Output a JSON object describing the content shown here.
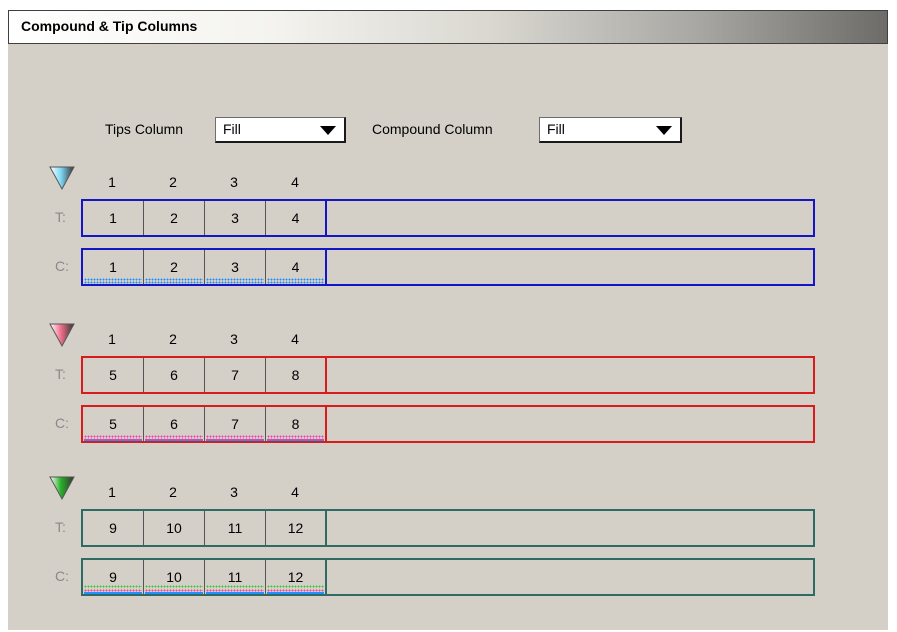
{
  "title": "Compound & Tip Columns",
  "controls": {
    "tips_label": "Tips Column",
    "tips_value": "Fill",
    "compound_label": "Compound Column",
    "compound_value": "Fill"
  },
  "row_labels": {
    "tips": "T:",
    "compound": "C:"
  },
  "groups": [
    {
      "color": "#1515c8",
      "triangle_color": "#7fd8f5",
      "headers": [
        "1",
        "2",
        "3",
        "4"
      ],
      "tips": [
        "1",
        "2",
        "3",
        "4"
      ],
      "compounds": [
        "1",
        "2",
        "3",
        "4"
      ]
    },
    {
      "color": "#d81c1c",
      "triangle_color": "#f0708c",
      "headers": [
        "1",
        "2",
        "3",
        "4"
      ],
      "tips": [
        "5",
        "6",
        "7",
        "8"
      ],
      "compounds": [
        "5",
        "6",
        "7",
        "8"
      ]
    },
    {
      "color": "#2f6b64",
      "triangle_color": "#28b028",
      "headers": [
        "1",
        "2",
        "3",
        "4"
      ],
      "tips": [
        "9",
        "10",
        "11",
        "12"
      ],
      "compounds": [
        "9",
        "10",
        "11",
        "12"
      ]
    }
  ]
}
